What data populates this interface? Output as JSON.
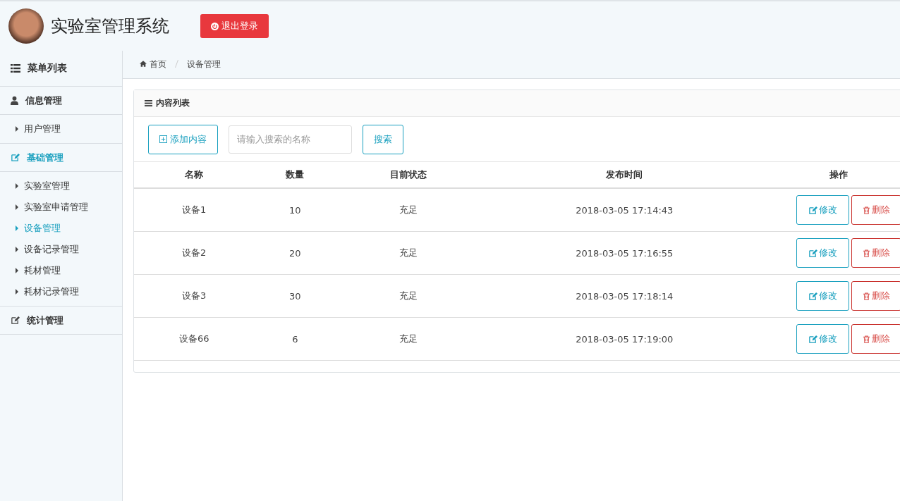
{
  "header": {
    "title": "实验室管理系统",
    "logout_button": "退出登录"
  },
  "sidebar": {
    "heading": "菜单列表",
    "groups": [
      {
        "label": "信息管理",
        "kind": "user",
        "selected": false,
        "children": [
          {
            "label": "用户管理",
            "selected": false
          }
        ]
      },
      {
        "label": "基础管理",
        "kind": "edit",
        "selected": true,
        "children": [
          {
            "label": "实验室管理",
            "selected": false
          },
          {
            "label": "实验室申请管理",
            "selected": false
          },
          {
            "label": "设备管理",
            "selected": true
          },
          {
            "label": "设备记录管理",
            "selected": false
          },
          {
            "label": "耗材管理",
            "selected": false
          },
          {
            "label": "耗材记录管理",
            "selected": false
          }
        ]
      },
      {
        "label": "统计管理",
        "kind": "edit",
        "selected": false
      }
    ]
  },
  "breadcrumb": [
    "首页",
    "设备管理"
  ],
  "panel": {
    "title": "内容列表",
    "add_button": "添加内容",
    "search": {
      "placeholder": "请输入搜索的名称"
    },
    "search_button": "搜索",
    "table": {
      "columns": [
        "名称",
        "数量",
        "目前状态",
        "发布时间",
        "操作"
      ],
      "rows": [
        {
          "name": "设备1",
          "quantity": "10",
          "status": "充足",
          "time": "2018-03-05 17:14:43",
          "edit": "修改",
          "delete": "删除"
        },
        {
          "name": "设备2",
          "quantity": "20",
          "status": "充足",
          "time": "2018-03-05 17:16:55",
          "edit": "修改",
          "delete": "删除"
        },
        {
          "name": "设备3",
          "quantity": "30",
          "status": "充足",
          "time": "2018-03-05 17:18:14",
          "edit": "修改",
          "delete": "删除"
        },
        {
          "name": "设备66",
          "quantity": "6",
          "status": "充足",
          "time": "2018-03-05 17:19:00",
          "edit": "修改",
          "delete": "删除"
        }
      ]
    }
  }
}
